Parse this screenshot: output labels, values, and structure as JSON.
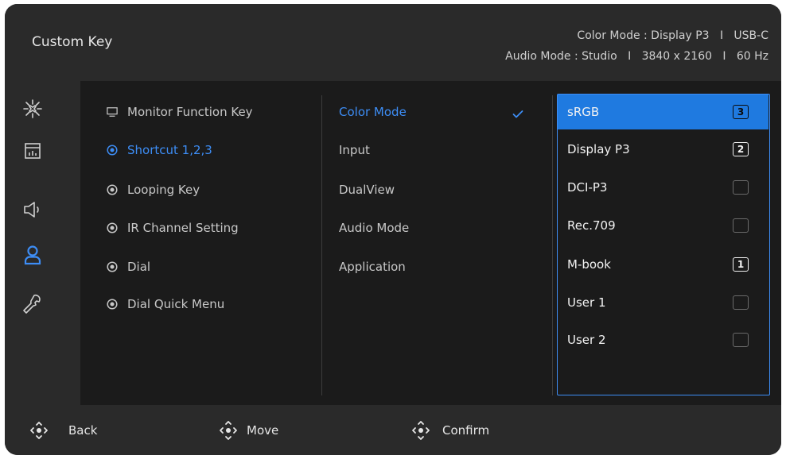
{
  "header": {
    "title": "Custom Key",
    "status_line1": "Color Mode : Display P3   I   USB-C",
    "status_line2": "Audio Mode : Studio   I   3840 x 2160   I   60 Hz"
  },
  "sidebar": {
    "items": [
      {
        "icon": "brightness-icon"
      },
      {
        "icon": "picture-icon"
      },
      {
        "icon": "speaker-icon"
      },
      {
        "icon": "user-icon",
        "active": true
      },
      {
        "icon": "wrench-icon"
      }
    ]
  },
  "menu": {
    "items": [
      {
        "label": "Monitor Function Key",
        "icon": "monitor-icon"
      },
      {
        "label": "Shortcut 1,2,3",
        "icon": "target-icon",
        "active": true
      },
      {
        "label": "Looping Key",
        "icon": "target-icon"
      },
      {
        "label": "IR Channel Setting",
        "icon": "target-icon"
      },
      {
        "label": "Dial",
        "icon": "target-icon"
      },
      {
        "label": "Dial Quick Menu",
        "icon": "target-icon"
      }
    ]
  },
  "submenu": {
    "items": [
      {
        "label": "Color Mode",
        "active": true,
        "checked": true
      },
      {
        "label": "Input"
      },
      {
        "label": "DualView"
      },
      {
        "label": "Audio Mode"
      },
      {
        "label": "Application"
      }
    ]
  },
  "options": {
    "items": [
      {
        "label": "sRGB",
        "slot": "3",
        "selected": true
      },
      {
        "label": "Display P3",
        "slot": "2"
      },
      {
        "label": "DCI-P3",
        "slot": ""
      },
      {
        "label": "Rec.709",
        "slot": ""
      },
      {
        "label": "M-book",
        "slot": "1"
      },
      {
        "label": "User 1",
        "slot": ""
      },
      {
        "label": "User 2",
        "slot": ""
      }
    ]
  },
  "footer": {
    "back_label": "Back",
    "move_label": "Move",
    "confirm_label": "Confirm"
  },
  "colors": {
    "accent": "#3d8df5",
    "selected_bg": "#1f7ae0",
    "panel_bg": "#1b1b1b",
    "header_bg": "#2a2a2a"
  }
}
